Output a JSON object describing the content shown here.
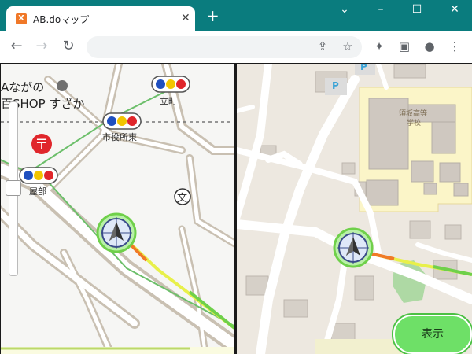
{
  "browser": {
    "tab_title": "AB.doマップ",
    "favicon_text": "X",
    "close_glyph": "✕",
    "newtab_glyph": "+",
    "window_controls": {
      "minimize": "–",
      "maximize": "☐",
      "close": "✕",
      "dropdown": "⌄"
    },
    "nav": {
      "back": "←",
      "forward": "→",
      "reload": "↻"
    },
    "toolbar_icons": {
      "share": "⇪",
      "bookmark": "☆",
      "extensions": "✦",
      "sidepanel": "▣",
      "profile": "●",
      "menu": "⋮"
    }
  },
  "left_map": {
    "labels": {
      "shop_line1": "Aながの",
      "shop_line2": "百SHOP すざか",
      "stop_tachimachi": "立町",
      "stop_shiyakusho": "市役所東",
      "stop_heya": "屋部",
      "school_symbol": "文"
    },
    "colors": {
      "signal_blue": "#1f4fbf",
      "signal_yellow": "#f2c500",
      "signal_red": "#e0262b",
      "post_office": "#e0262b"
    }
  },
  "right_map": {
    "labels": {
      "school_name_line1": "須坂高等",
      "school_name_line2": "学校",
      "parking_1": "P",
      "parking_2": "P"
    }
  },
  "show_button": {
    "label": "表示"
  }
}
